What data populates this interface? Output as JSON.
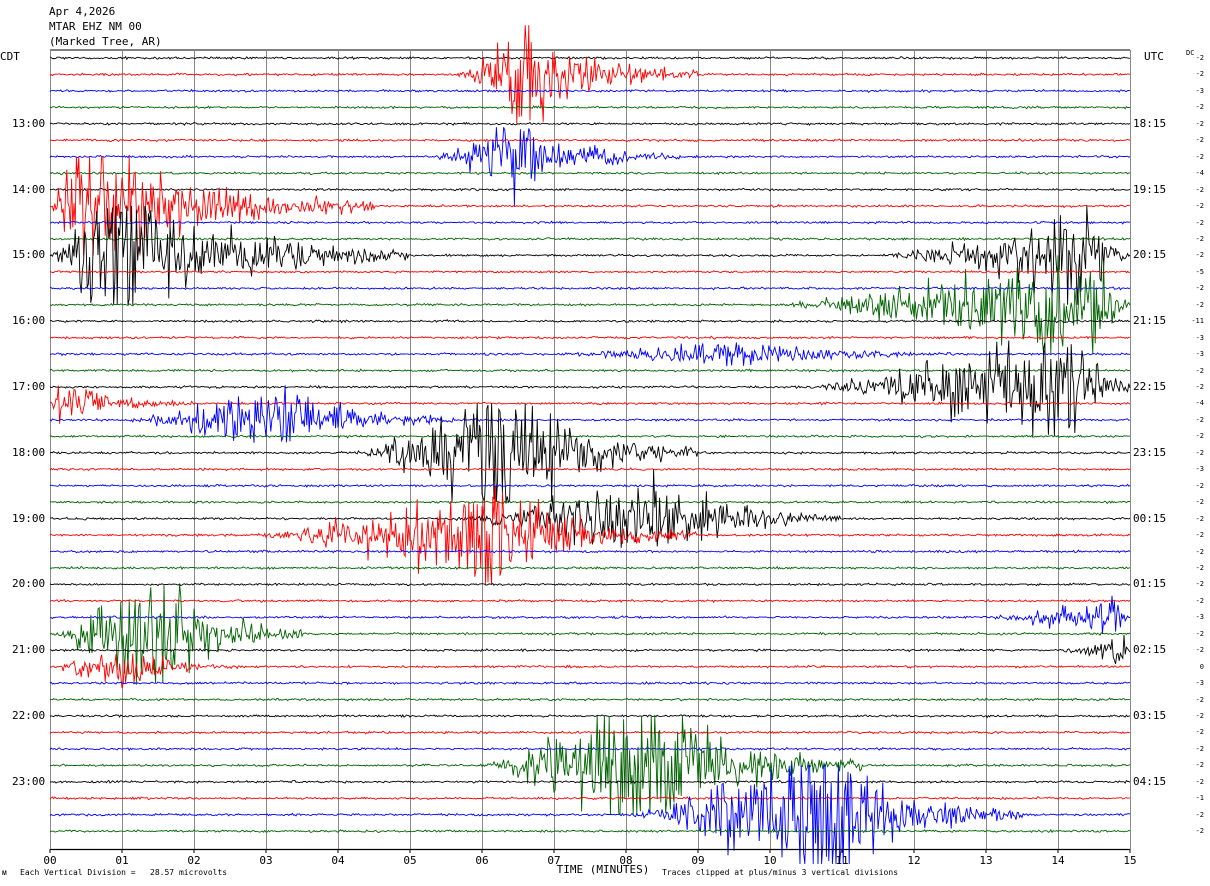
{
  "header": {
    "date": "Apr 4,2026",
    "station": "MTAR EHZ NM 00",
    "location": "(Marked Tree, AR)"
  },
  "left_zone": "CDT",
  "right_zone": "UTC",
  "dc_label": "DC",
  "footer": {
    "vertical_division": "Each Vertical Division =   28.57 microvolts",
    "clipped": "Traces clipped at plus/minus 3 vertical divisions",
    "corner": "ᴍ"
  },
  "chart_data": {
    "type": "seismogram",
    "xlabel": "TIME (MINUTES)",
    "xlim": [
      0,
      15
    ],
    "x_ticks": [
      "00",
      "01",
      "02",
      "03",
      "04",
      "05",
      "06",
      "07",
      "08",
      "09",
      "10",
      "11",
      "12",
      "13",
      "14",
      "15"
    ],
    "traces_per_hour": 4,
    "trace_colors": [
      "#000000",
      "#ff0000",
      "#0000ff",
      "#006400"
    ],
    "left_hour_labels": [
      {
        "trace": 4,
        "label": "13:00"
      },
      {
        "trace": 8,
        "label": "14:00"
      },
      {
        "trace": 12,
        "label": "15:00"
      },
      {
        "trace": 16,
        "label": "16:00"
      },
      {
        "trace": 20,
        "label": "17:00"
      },
      {
        "trace": 24,
        "label": "18:00"
      },
      {
        "trace": 28,
        "label": "19:00"
      },
      {
        "trace": 32,
        "label": "20:00"
      },
      {
        "trace": 36,
        "label": "21:00"
      },
      {
        "trace": 40,
        "label": "22:00"
      },
      {
        "trace": 44,
        "label": "23:00"
      }
    ],
    "right_hour_labels": [
      {
        "trace": 4,
        "label": "18:15"
      },
      {
        "trace": 8,
        "label": "19:15"
      },
      {
        "trace": 12,
        "label": "20:15"
      },
      {
        "trace": 16,
        "label": "21:15"
      },
      {
        "trace": 20,
        "label": "22:15"
      },
      {
        "trace": 24,
        "label": "23:15"
      },
      {
        "trace": 28,
        "label": "00:15"
      },
      {
        "trace": 32,
        "label": "01:15"
      },
      {
        "trace": 36,
        "label": "02:15"
      },
      {
        "trace": 40,
        "label": "03:15"
      },
      {
        "trace": 44,
        "label": "04:15"
      }
    ],
    "dc_offsets": [
      "-2",
      "-2",
      "-3",
      "-2",
      "-2",
      "-2",
      "-2",
      "-4",
      "-2",
      "-2",
      "-2",
      "-2",
      "-2",
      "-5",
      "-2",
      "-2",
      "-11",
      "-3",
      "-3",
      "-2",
      "-2",
      "-4",
      "-2",
      "-2",
      "-2",
      "-3",
      "-2",
      "-2",
      "-2",
      "-2",
      "-2",
      "-2",
      "-2",
      "-2",
      "-3",
      "-2",
      "-2",
      "0",
      "-3",
      "-2",
      "-2",
      "-2",
      "-2",
      "-2",
      "-2",
      "-1",
      "-2",
      "-2"
    ],
    "events": [
      {
        "trace": 1,
        "start_min": 5.6,
        "peak_min": 6.6,
        "end_min": 9.0,
        "amp": 2.6
      },
      {
        "trace": 6,
        "start_min": 5.3,
        "peak_min": 6.4,
        "end_min": 8.8,
        "amp": 2.0
      },
      {
        "trace": 9,
        "start_min": 0.0,
        "peak_min": 0.4,
        "end_min": 4.5,
        "amp": 4.2
      },
      {
        "trace": 12,
        "start_min": 0.0,
        "peak_min": 0.8,
        "end_min": 5.0,
        "amp": 4.2
      },
      {
        "trace": 12,
        "start_min": 11.5,
        "peak_min": 14.5,
        "end_min": 15.0,
        "amp": 2.6
      },
      {
        "trace": 15,
        "start_min": 10.0,
        "peak_min": 14.6,
        "end_min": 15.0,
        "amp": 3.2
      },
      {
        "trace": 18,
        "start_min": 7.0,
        "peak_min": 9.5,
        "end_min": 12.5,
        "amp": 0.7
      },
      {
        "trace": 20,
        "start_min": 10.5,
        "peak_min": 14.2,
        "end_min": 15.0,
        "amp": 3.4
      },
      {
        "trace": 21,
        "start_min": 0.0,
        "peak_min": 0.1,
        "end_min": 2.0,
        "amp": 1.2
      },
      {
        "trace": 22,
        "start_min": 1.0,
        "peak_min": 3.2,
        "end_min": 5.6,
        "amp": 2.0
      },
      {
        "trace": 24,
        "start_min": 4.2,
        "peak_min": 6.3,
        "end_min": 9.0,
        "amp": 4.2
      },
      {
        "trace": 29,
        "start_min": 2.8,
        "peak_min": 6.2,
        "end_min": 9.0,
        "amp": 2.8
      },
      {
        "trace": 28,
        "start_min": 5.5,
        "peak_min": 8.5,
        "end_min": 11.0,
        "amp": 2.4
      },
      {
        "trace": 34,
        "start_min": 13.0,
        "peak_min": 14.8,
        "end_min": 15.0,
        "amp": 1.2
      },
      {
        "trace": 35,
        "start_min": 0.0,
        "peak_min": 1.5,
        "end_min": 3.5,
        "amp": 4.0
      },
      {
        "trace": 36,
        "start_min": 14.0,
        "peak_min": 14.9,
        "end_min": 15.0,
        "amp": 1.0
      },
      {
        "trace": 37,
        "start_min": 0.0,
        "peak_min": 1.0,
        "end_min": 2.6,
        "amp": 1.2
      },
      {
        "trace": 43,
        "start_min": 6.0,
        "peak_min": 8.2,
        "end_min": 11.3,
        "amp": 4.2
      },
      {
        "trace": 46,
        "start_min": 8.0,
        "peak_min": 10.7,
        "end_min": 13.5,
        "amp": 4.2
      }
    ]
  }
}
